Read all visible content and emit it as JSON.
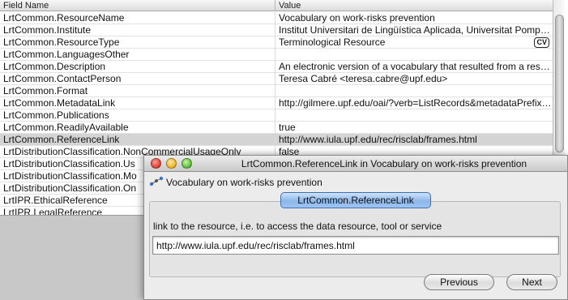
{
  "table": {
    "columns": {
      "field": "Field Name",
      "value": "Value"
    },
    "rows": [
      {
        "field": "LrtCommon.ResourceName",
        "value": "Vocabulary on work-risks prevention"
      },
      {
        "field": "LrtCommon.Institute",
        "value": "Institut Universitari de Lingüística Aplicada, Universitat Pompeu Fabra"
      },
      {
        "field": "LrtCommon.ResourceType",
        "value": "Terminological Resource",
        "badge": "CV"
      },
      {
        "field": "LrtCommon.LanguagesOther",
        "value": ""
      },
      {
        "field": "LrtCommon.Description",
        "value": "An electronic version of a vocabulary that resulted from a research project"
      },
      {
        "field": "LrtCommon.ContactPerson",
        "value": "Teresa Cabré <teresa.cabre@upf.edu>"
      },
      {
        "field": "LrtCommon.Format",
        "value": ""
      },
      {
        "field": "LrtCommon.MetadataLink",
        "value": "http://gilmere.upf.edu/oai/?verb=ListRecords&metadataPrefix=olac"
      },
      {
        "field": "LrtCommon.Publications",
        "value": ""
      },
      {
        "field": "LrtCommon.ReadilyAvailable",
        "value": "true"
      },
      {
        "field": "LrtCommon.ReferenceLink",
        "value": "http://www.iula.upf.edu/rec/risclab/frames.html",
        "selected": true
      },
      {
        "field": "LrtDistributionClassification.NonCommercialUsageOnly",
        "value": "false"
      },
      {
        "field": "LrtDistributionClassification.Us",
        "value": ""
      },
      {
        "field": "LrtDistributionClassification.Mo",
        "value": ""
      },
      {
        "field": "LrtDistributionClassification.On",
        "value": ""
      },
      {
        "field": "LrtIPR.EthicalReference",
        "value": ""
      },
      {
        "field": "LrtIPR.LegalReference",
        "value": ""
      }
    ]
  },
  "dialog": {
    "title": "LrtCommon.ReferenceLink in Vocabulary on work-risks prevention",
    "resource_name": "Vocabulary on work-risks prevention",
    "resource_icon": "link-node-icon",
    "tab_label": "LrtCommon.ReferenceLink",
    "field_description": "link to the resource, i.e. to access the data resource, tool or service",
    "value": "http://www.iula.upf.edu/rec/risclab/frames.html",
    "previous_label": "Previous",
    "next_label": "Next"
  },
  "colors": {
    "selected_row": "#d4d4d4",
    "tab_blue": "#8cb7ea",
    "window_close": "#e0443a",
    "window_minimize": "#f0b52c",
    "window_zoom": "#5fbf3a"
  }
}
